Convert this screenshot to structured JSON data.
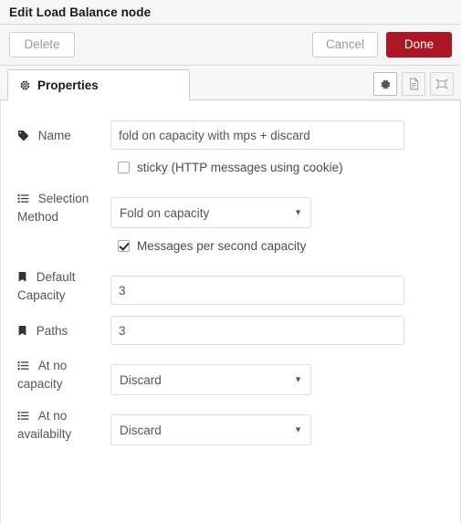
{
  "window": {
    "title": "Edit Load Balance node"
  },
  "toolbar": {
    "delete_label": "Delete",
    "cancel_label": "Cancel",
    "done_label": "Done",
    "primary_color": "#ad1625"
  },
  "tabs": [
    {
      "label": "Properties",
      "icon": "gear-icon",
      "active": true
    }
  ],
  "tab_tools": [
    {
      "name": "gear-icon",
      "active": true
    },
    {
      "name": "description-icon",
      "active": false
    },
    {
      "name": "appearance-icon",
      "active": false
    }
  ],
  "form": {
    "name": {
      "label": "Name",
      "icon": "tag-icon",
      "value": "fold on capacity with mps + discard",
      "placeholder": "Name"
    },
    "sticky": {
      "label": "sticky (HTTP messages using cookie)",
      "checked": false
    },
    "selection_method": {
      "label": "Selection Method",
      "icon": "list-icon",
      "value": "Fold on capacity",
      "options": [
        "Fold on capacity"
      ]
    },
    "mps_capacity": {
      "label": "Messages per second capacity",
      "checked": true
    },
    "default_capacity": {
      "label": "Default Capacity",
      "icon": "bookmark-icon",
      "value": "3",
      "placeholder": "Default Capacity"
    },
    "paths": {
      "label": "Paths",
      "icon": "bookmark-icon",
      "value": "3",
      "placeholder": "Paths"
    },
    "at_no_capacity": {
      "label": "At no capacity",
      "icon": "list-icon",
      "value": "Discard",
      "options": [
        "Discard"
      ]
    },
    "at_no_availability": {
      "label": "At no availabilty",
      "icon": "list-icon",
      "value": "Discard",
      "options": [
        "Discard"
      ]
    }
  }
}
